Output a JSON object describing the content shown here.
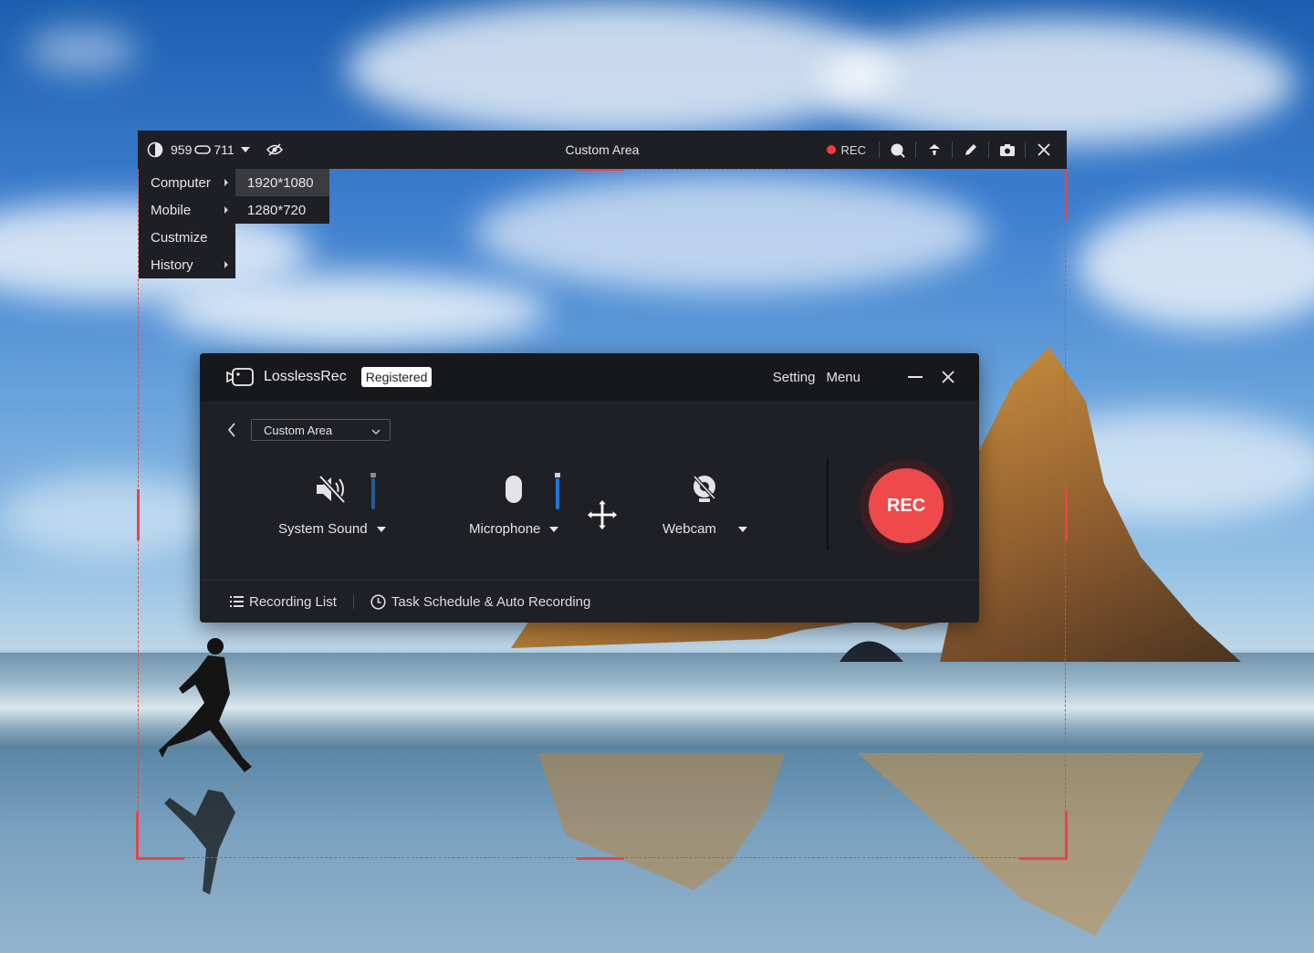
{
  "toolbar": {
    "width": "959",
    "height": "711",
    "title": "Custom Area",
    "rec_label": "REC"
  },
  "size_menu": {
    "items": [
      {
        "label": "Computer",
        "has_submenu": true
      },
      {
        "label": "Mobile",
        "has_submenu": true
      },
      {
        "label": "Custmize",
        "has_submenu": false
      },
      {
        "label": "History",
        "has_submenu": true
      }
    ],
    "submenu": [
      "1920*1080",
      "1280*720"
    ]
  },
  "panel": {
    "app_name": "LosslessRec",
    "badge": "Registered",
    "setting_label": "Setting",
    "menu_label": "Menu",
    "mode_select": "Custom Area",
    "controls": {
      "system_sound": {
        "label": "System Sound",
        "level": 0.85
      },
      "microphone": {
        "label": "Microphone",
        "level": 0.85
      },
      "webcam": {
        "label": "Webcam"
      }
    },
    "rec_button": "REC",
    "footer": {
      "recording_list": "Recording List",
      "task_schedule": "Task Schedule & Auto Recording"
    }
  },
  "colors": {
    "accent_red": "#ee4a4a",
    "slider_blue": "#1e78e0",
    "panel_bg": "#1f2026"
  }
}
